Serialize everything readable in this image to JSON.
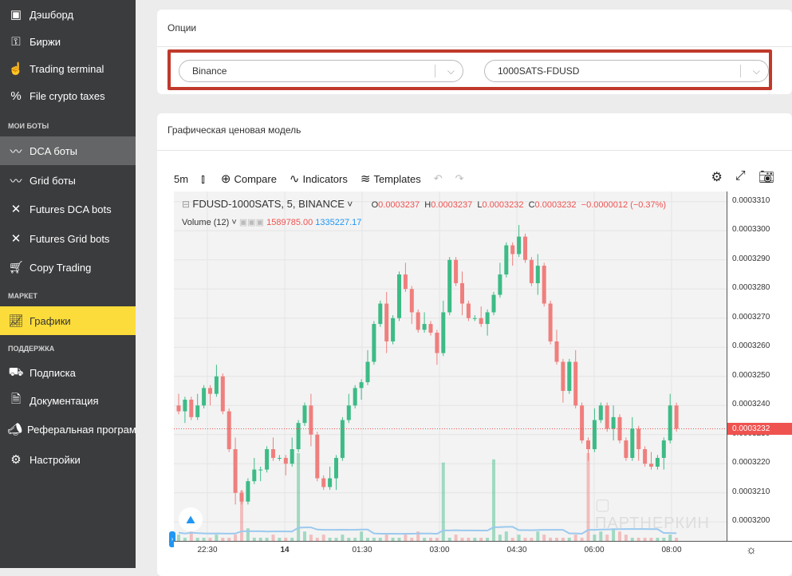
{
  "sidebar": {
    "items": [
      {
        "label": "Дэшборд",
        "icon": "dashboard-icon"
      },
      {
        "label": "Биржи",
        "icon": "key-icon"
      },
      {
        "label": "Trading terminal",
        "icon": "hand-pointer-icon"
      },
      {
        "label": "File crypto taxes",
        "icon": "percent-icon"
      }
    ],
    "section_bots": "МОИ БОТЫ",
    "bots": [
      {
        "label": "DCA боты",
        "icon": "dca-bot-icon"
      },
      {
        "label": "Grid боты",
        "icon": "grid-bot-icon"
      },
      {
        "label": "Futures DCA bots",
        "icon": "futures-dca-icon"
      },
      {
        "label": "Futures Grid bots",
        "icon": "futures-grid-icon"
      },
      {
        "label": "Copy Trading",
        "icon": "cart-icon"
      }
    ],
    "section_market": "МАРКЕТ",
    "market": [
      {
        "label": "Графики",
        "icon": "chart-icon"
      }
    ],
    "section_support": "ПОДДЕРЖКА",
    "support": [
      {
        "label": "Подписка",
        "icon": "cart-plus-icon"
      },
      {
        "label": "Документация",
        "icon": "document-icon"
      },
      {
        "label": "Реферальная программа",
        "icon": "megaphone-icon"
      },
      {
        "label": "Настройки",
        "icon": "gear-icon"
      }
    ]
  },
  "options": {
    "title": "Опции",
    "exchange": "Binance",
    "pair": "1000SATS-FDUSD"
  },
  "chart_card": {
    "title": "Графическая ценовая модель"
  },
  "toolbar": {
    "interval": "5m",
    "compare": "Compare",
    "indicators": "Indicators",
    "templates": "Templates"
  },
  "legend": {
    "symbol": "FDUSD-1000SATS, 5, BINANCE",
    "o_label": "O",
    "o": "0.0003237",
    "h_label": "H",
    "h": "0.0003237",
    "l_label": "L",
    "l": "0.0003232",
    "c_label": "C",
    "c": "0.0003232",
    "change": "−0.0000012 (−0.37%)",
    "volume_label": "Volume (12)",
    "vol1": "1589785.00",
    "vol2": "1335227.17"
  },
  "watermark": "ПАРТНЕРКИН",
  "chart_data": {
    "type": "candlestick",
    "price_ticks": [
      "0.0003310",
      "0.0003300",
      "0.0003290",
      "0.0003280",
      "0.0003270",
      "0.0003260",
      "0.0003250",
      "0.0003240",
      "0.0003230",
      "0.0003220",
      "0.0003210",
      "0.0003200"
    ],
    "ylim": [
      0.00031935,
      0.00033135
    ],
    "last_price": "0.0003232",
    "time_ticks": [
      "22:30",
      "14",
      "01:30",
      "03:00",
      "04:30",
      "06:00",
      "08:00"
    ],
    "closes": [
      3238,
      3242,
      3236,
      3240,
      3246,
      3244,
      3250,
      3238,
      3225,
      3210,
      3207,
      3214,
      3218,
      3218,
      3225,
      3222,
      3222,
      3220,
      3225,
      3234,
      3240,
      3230,
      3215,
      3212,
      3215,
      3222,
      3235,
      3240,
      3246,
      3248,
      3255,
      3268,
      3275,
      3262,
      3270,
      3285,
      3280,
      3272,
      3266,
      3268,
      3265,
      3258,
      3272,
      3290,
      3282,
      3275,
      3270,
      3270,
      3268,
      3272,
      3278,
      3285,
      3295,
      3292,
      3298,
      3290,
      3282,
      3288,
      3275,
      3262,
      3255,
      3245,
      3255,
      3240,
      3228,
      3225,
      3235,
      3240,
      3232,
      3236,
      3228,
      3222,
      3232,
      3225,
      3220,
      3219,
      3222,
      3228,
      3240,
      3232
    ],
    "volumes": [
      2,
      1,
      3,
      1,
      1,
      1,
      2,
      1,
      1,
      2,
      16,
      4,
      1,
      1,
      1,
      2,
      1,
      1,
      1,
      28,
      3,
      2,
      1,
      2,
      1,
      1,
      2,
      1,
      1,
      3,
      1,
      1,
      1,
      2,
      1,
      1,
      2,
      1,
      3,
      1,
      1,
      1,
      25,
      1,
      2,
      1,
      1,
      1,
      1,
      1,
      26,
      2,
      3,
      1,
      2,
      1,
      1,
      3,
      2,
      1,
      1,
      1,
      1,
      2,
      1,
      28,
      2,
      3,
      2,
      4,
      3,
      2,
      1,
      1,
      1,
      1,
      1,
      1,
      2,
      1
    ],
    "up_color": "#3dbb86",
    "down_color": "#ef7f7d",
    "ma_color": "#9cc9ee"
  }
}
